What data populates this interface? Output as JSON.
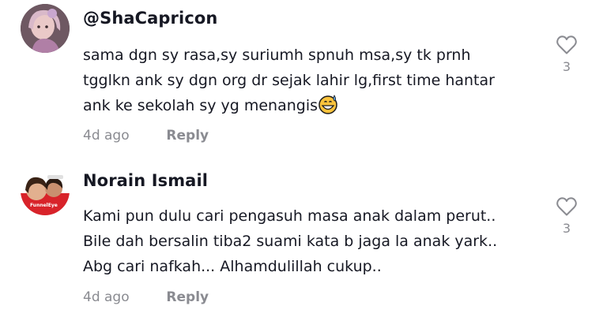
{
  "comments": [
    {
      "username": "@ShaCapricon",
      "text": "sama dgn sy rasa,sy suriumh spnuh msa,sy tk prnh\ntgglkn ank sy dgn org dr sejak lahir lg,first time hantar\nank ke sekolah sy yg menangis",
      "emoji": "grinning-sweat-emoji",
      "date": "4d ago",
      "reply_label": "Reply",
      "likes": "3"
    },
    {
      "username": "Norain Ismail",
      "text": "Kami pun dulu cari pengasuh masa anak dalam perut..\nBile dah bersalin tiba2 suami kata b jaga la anak yark..\nAbg cari nafkah... Alhamdulillah cukup..",
      "date": "4d ago",
      "reply_label": "Reply",
      "likes": "3",
      "avatar_badge": "FunnelEye"
    }
  ],
  "colors": {
    "text": "#161823",
    "muted": "#8a8b91",
    "emoji_face": "#f9c23c",
    "emoji_sweat": "#5fa8e8"
  }
}
